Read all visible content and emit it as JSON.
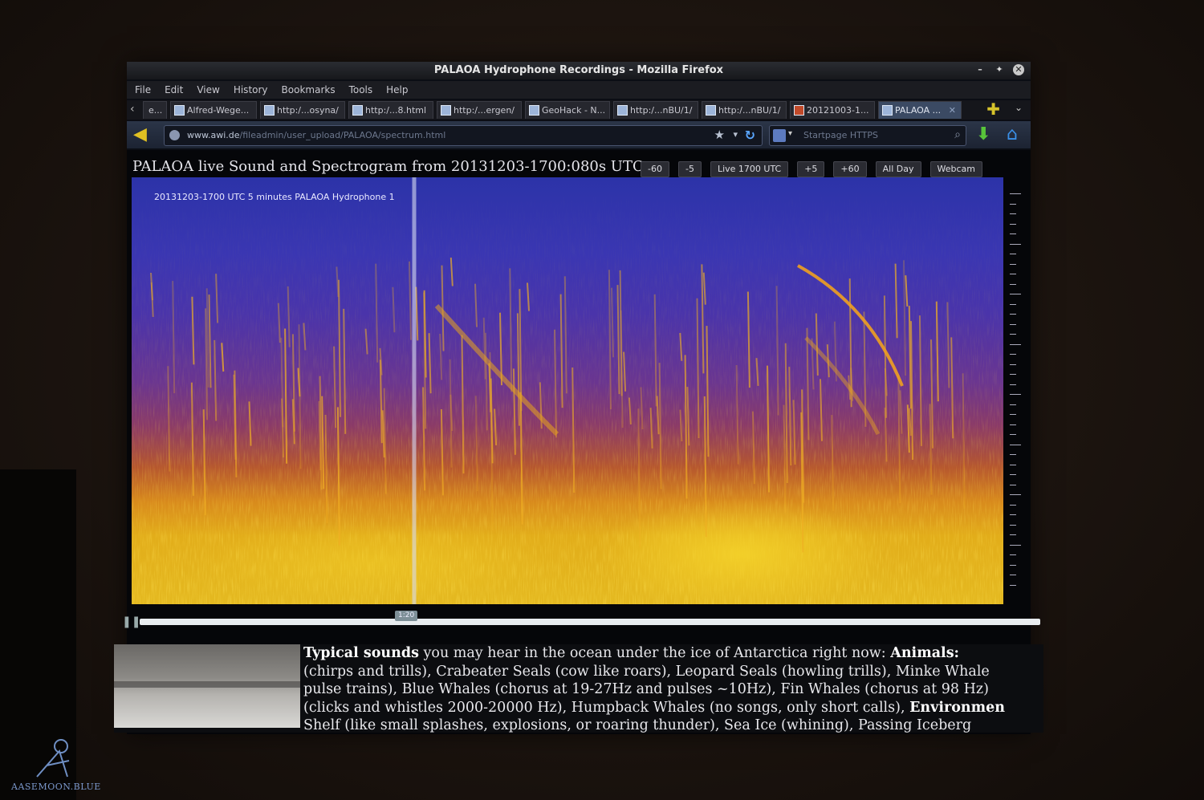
{
  "window": {
    "title": "PALAOA Hydrophone Recordings - Mozilla Firefox",
    "controls": [
      "minimize-icon",
      "maximize-icon",
      "close-icon"
    ]
  },
  "menu": [
    "File",
    "Edit",
    "View",
    "History",
    "Bookmarks",
    "Tools",
    "Help"
  ],
  "tabs": [
    {
      "label": "e..."
    },
    {
      "label": "Alfred-Wege..."
    },
    {
      "label": "http:/...osyna/"
    },
    {
      "label": "http:/...8.html"
    },
    {
      "label": "http:/...ergen/"
    },
    {
      "label": "GeoHack - N..."
    },
    {
      "label": "http:/...nBU/1/"
    },
    {
      "label": "http:/...nBU/1/"
    },
    {
      "label": "20121003-1..."
    },
    {
      "label": "PALAOA ..."
    }
  ],
  "toolbar": {
    "url_domain": "www.awi.de",
    "url_path": "/fileadmin/user_upload/PALAOA/spectrum.html",
    "search_placeholder": "Startpage HTTPS"
  },
  "page": {
    "heading": "PALAOA live Sound and Spectrogram from 20131203-1700:080s UTC",
    "buttons": [
      "-60",
      "-5",
      "Live 1700 UTC",
      "+5",
      "+60",
      "All Day",
      "Webcam"
    ],
    "spectrogram_label": "20131203-1700 UTC  5 minutes  PALAOA Hydrophone 1",
    "playback_position": "1:20",
    "typical_sounds_lead": "Typical sounds",
    "line1": " you may hear in the ocean under the ice of Antarctica right now: ",
    "animals_label": "Animals:",
    "line2": "(chirps and trills), Crabeater Seals (cow like roars), Leopard Seals (howling trills), Minke Whale",
    "line3": "pulse trains), Blue Whales (chorus at 19-27Hz and pulses ~10Hz), Fin Whales (chorus at 98 Hz)",
    "line4": "(clicks and whistles 2000-20000 Hz), Humpback Whales (no songs, only short calls), ",
    "environment_label": "Environmen",
    "line5": "Shelf (like small splashes, explosions, or roaring thunder), Sea Ice (whining), Passing Iceberg"
  },
  "watermark": "AASEMOON.BLUE",
  "colors": {
    "spectrogram_low": "#2c33a8",
    "spectrogram_high": "#e4b920",
    "accent_home": "#3b90e8",
    "accent_download": "#58c43a"
  }
}
